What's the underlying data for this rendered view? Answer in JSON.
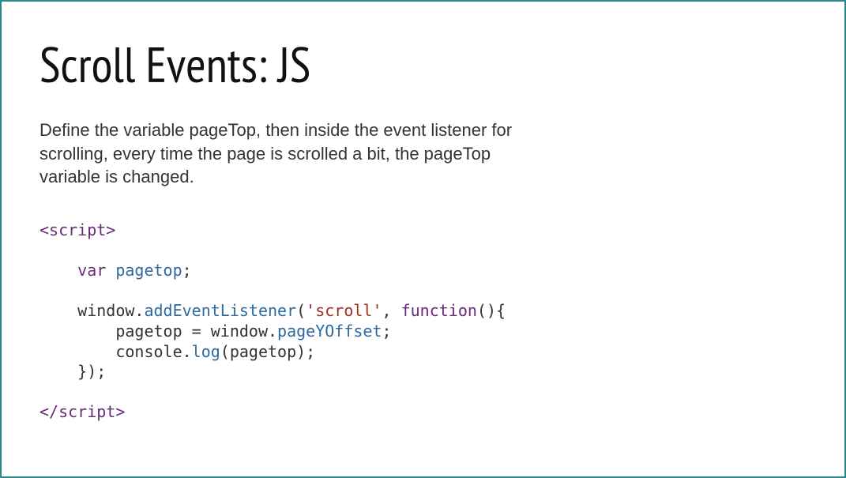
{
  "title": "Scroll Events: JS",
  "description": "Define the variable pageTop, then inside the event listener for scrolling, every time the page is scrolled a bit, the pageTop variable is changed.",
  "code": {
    "open_tag": "<script>",
    "l1_kw": "var",
    "l1_sp": " ",
    "l1_var": "pagetop",
    "l1_end": ";",
    "l2_obj": "window",
    "l2_dot1": ".",
    "l2_func": "addEventListener",
    "l2_paren_open": "(",
    "l2_str": "'scroll'",
    "l2_comma": ", ",
    "l2_kw": "function",
    "l2_tail": "(){",
    "l3_left": "pagetop = window.",
    "l3_prop": "pageYOffset",
    "l3_end": ";",
    "l4_left": "console.",
    "l4_func": "log",
    "l4_mid": "(pagetop);",
    "l5": "});",
    "close_tag": "</script>"
  }
}
